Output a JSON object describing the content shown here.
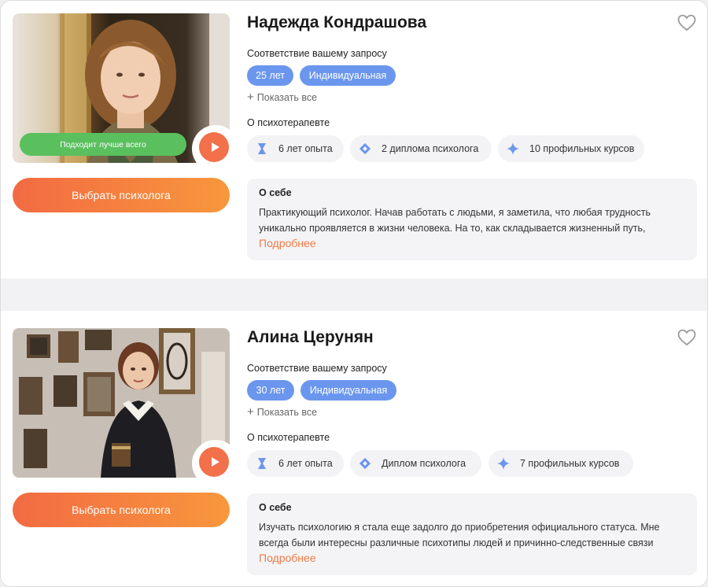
{
  "colors": {
    "accent_orange": "#f2704a",
    "tag_blue": "#6b96ee",
    "badge_green": "#5ac05e",
    "link_orange": "#ef7a45"
  },
  "psychologists": [
    {
      "name": "Надежда Кондрашова",
      "match_label": "Соответствие вашему запросу",
      "tags": [
        "25 лет",
        "Индивидуальная"
      ],
      "show_all": "Показать все",
      "about_therapist_label": "О психотерапевте",
      "best_badge": "Подходит лучше всего",
      "stats": [
        {
          "icon": "hourglass-icon",
          "label": "6 лет опыта"
        },
        {
          "icon": "diploma-icon",
          "label": "2 диплома психолога"
        },
        {
          "icon": "sparkle-icon",
          "label": "10 профильных курсов"
        }
      ],
      "about": {
        "title": "О себе",
        "text": "Практикующий психолог. Начав работать с людьми, я заметила, что любая трудность уникально проявляется в жизни человека. На то, как складывается жизненный путь,",
        "more": "Подробнее"
      },
      "choose_label": "Выбрать психолога"
    },
    {
      "name": "Алина Церунян",
      "match_label": "Соответствие вашему запросу",
      "tags": [
        "30 лет",
        "Индивидуальная"
      ],
      "show_all": "Показать все",
      "about_therapist_label": "О психотерапевте",
      "stats": [
        {
          "icon": "hourglass-icon",
          "label": "6 лет опыта"
        },
        {
          "icon": "diploma-icon",
          "label": "Диплом психолога"
        },
        {
          "icon": "sparkle-icon",
          "label": "7 профильных курсов"
        }
      ],
      "about": {
        "title": "О себе",
        "text": "Изучать психологию я стала еще задолго до приобретения официального статуса. Мне всегда были интересны различные психотипы людей и причинно-следственные связи",
        "more": "Подробнее"
      },
      "choose_label": "Выбрать психолога"
    }
  ]
}
